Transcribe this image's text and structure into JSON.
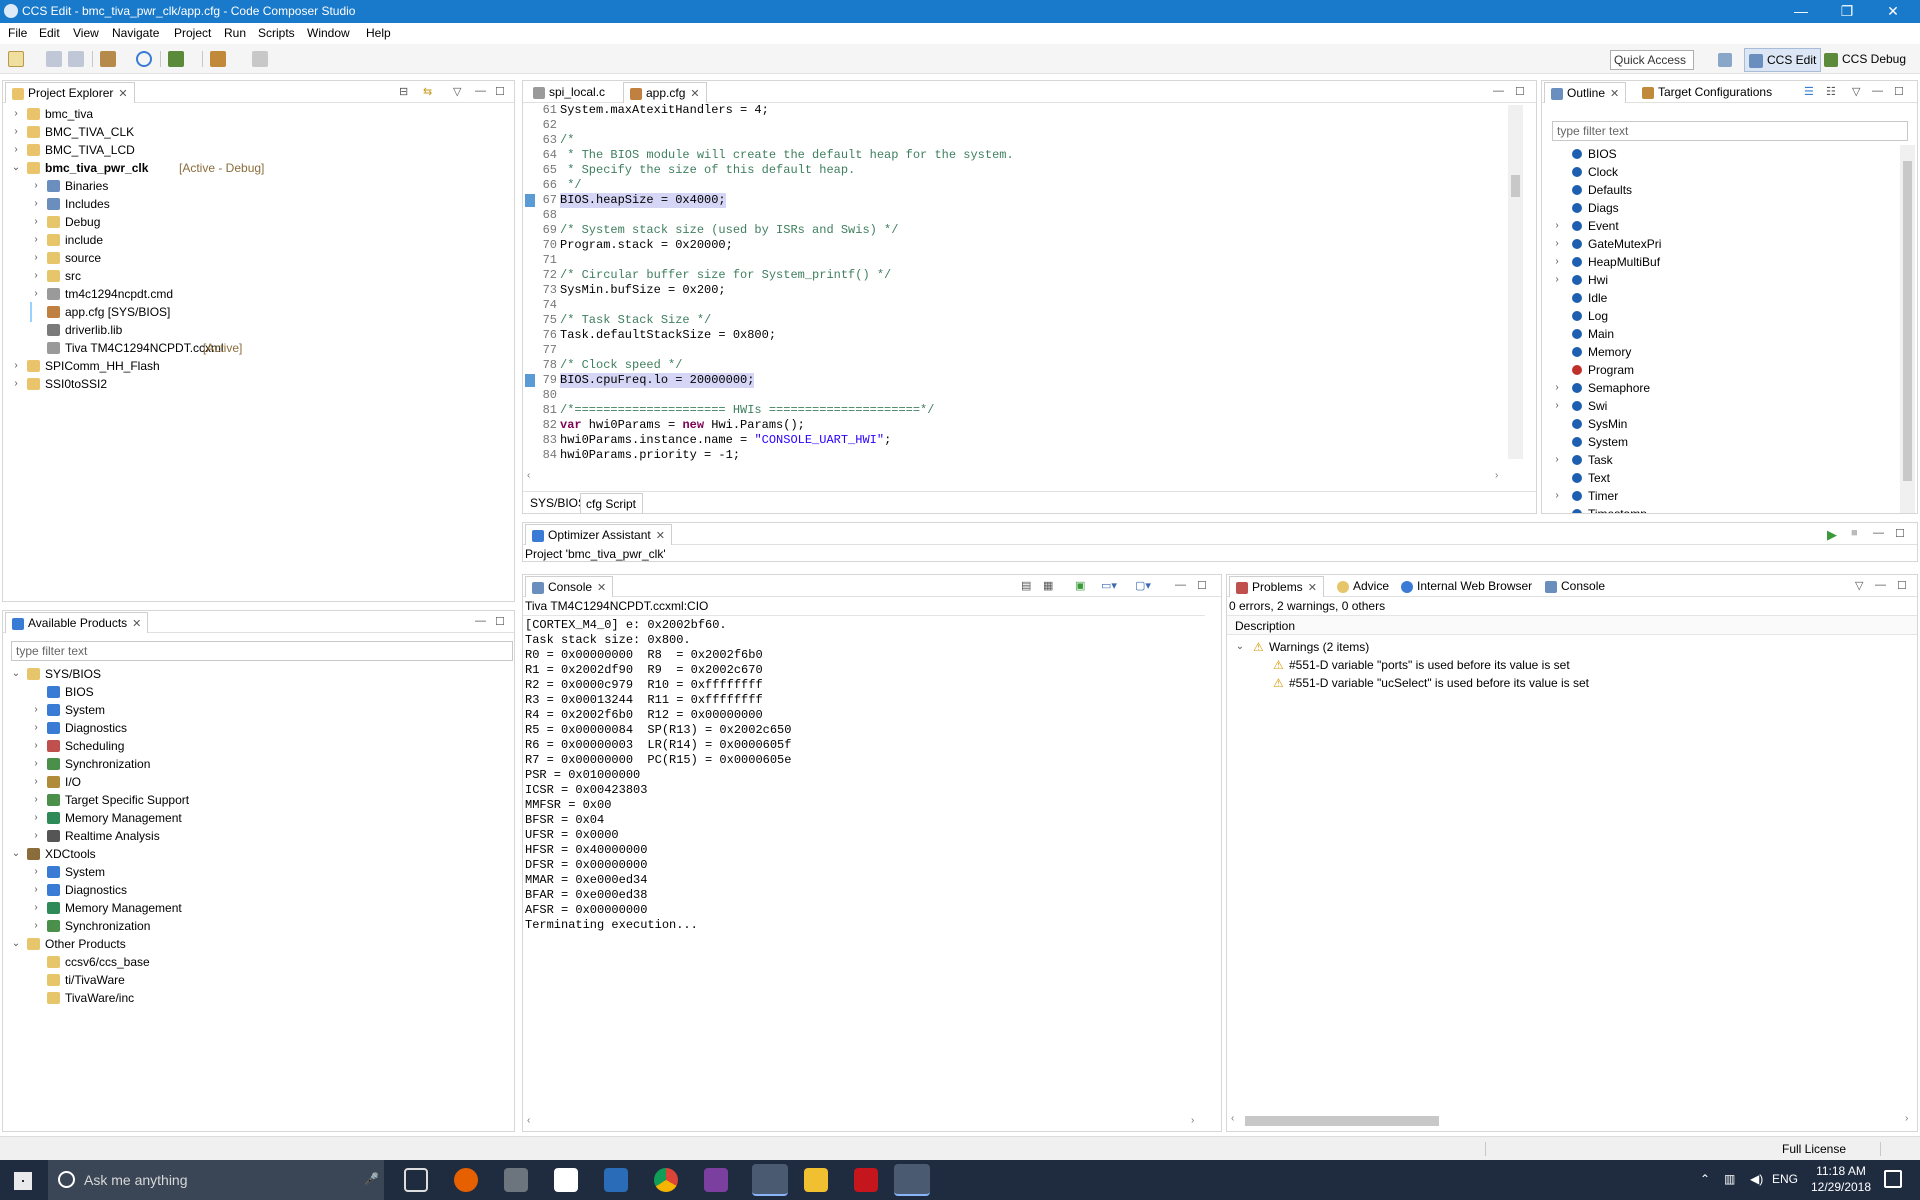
{
  "window": {
    "title": "CCS Edit - bmc_tiva_pwr_clk/app.cfg - Code Composer Studio"
  },
  "menu": [
    "File",
    "Edit",
    "View",
    "Navigate",
    "Project",
    "Run",
    "Scripts",
    "Window",
    "Help"
  ],
  "toolbar": {
    "quick_access": "Quick Access",
    "perspectives": [
      "CCS Edit",
      "CCS Debug"
    ]
  },
  "project_explorer": {
    "title": "Project Explorer",
    "items": [
      {
        "label": "bmc_tiva",
        "indent": 0,
        "arrow": "›",
        "icon": "#e9c46a"
      },
      {
        "label": "BMC_TIVA_CLK",
        "indent": 0,
        "arrow": "›",
        "icon": "#e9c46a"
      },
      {
        "label": "BMC_TIVA_LCD",
        "indent": 0,
        "arrow": "›",
        "icon": "#e9c46a"
      },
      {
        "label": "bmc_tiva_pwr_clk",
        "suffix": "[Active - Debug]",
        "bold": true,
        "indent": 0,
        "arrow": "⌄",
        "icon": "#e9c46a"
      },
      {
        "label": "Binaries",
        "indent": 1,
        "arrow": "›",
        "icon": "#6a8fbf"
      },
      {
        "label": "Includes",
        "indent": 1,
        "arrow": "›",
        "icon": "#6a8fbf"
      },
      {
        "label": "Debug",
        "indent": 1,
        "arrow": "›",
        "icon": "#e7c66b"
      },
      {
        "label": "include",
        "indent": 1,
        "arrow": "›",
        "icon": "#e7c66b"
      },
      {
        "label": "source",
        "indent": 1,
        "arrow": "›",
        "icon": "#e7c66b"
      },
      {
        "label": "src",
        "indent": 1,
        "arrow": "›",
        "icon": "#e7c66b"
      },
      {
        "label": "tm4c1294ncpdt.cmd",
        "indent": 1,
        "arrow": "›",
        "icon": "#9a9a9a"
      },
      {
        "label": "app.cfg [SYS/BIOS]",
        "indent": 1,
        "arrow": "",
        "icon": "#c08040",
        "selected": true
      },
      {
        "label": "driverlib.lib",
        "indent": 1,
        "arrow": "",
        "icon": "#7a7a7a"
      },
      {
        "label": "Tiva TM4C1294NCPDT.ccxml",
        "suffix": "[Active]",
        "indent": 1,
        "arrow": "",
        "icon": "#9a9a9a"
      },
      {
        "label": "SPIComm_HH_Flash",
        "indent": 0,
        "arrow": "›",
        "icon": "#e9c46a"
      },
      {
        "label": "SSI0toSSI2",
        "indent": 0,
        "arrow": "›",
        "icon": "#e9c46a"
      }
    ]
  },
  "available_products": {
    "title": "Available Products",
    "filter_placeholder": "type filter text",
    "items": [
      {
        "label": "SYS/BIOS",
        "indent": 0,
        "arrow": "⌄",
        "icon": "#e7c66b"
      },
      {
        "label": "BIOS",
        "indent": 1,
        "arrow": "",
        "icon": "#3a7bd5"
      },
      {
        "label": "System",
        "indent": 1,
        "arrow": "›",
        "icon": "#3a7bd5"
      },
      {
        "label": "Diagnostics",
        "indent": 1,
        "arrow": "›",
        "icon": "#3a7bd5"
      },
      {
        "label": "Scheduling",
        "indent": 1,
        "arrow": "›",
        "icon": "#c0504d"
      },
      {
        "label": "Synchronization",
        "indent": 1,
        "arrow": "›",
        "icon": "#4a8f4a"
      },
      {
        "label": "I/O",
        "indent": 1,
        "arrow": "›",
        "icon": "#b08b3a"
      },
      {
        "label": "Target Specific Support",
        "indent": 1,
        "arrow": "›",
        "icon": "#4a8f4a"
      },
      {
        "label": "Memory Management",
        "indent": 1,
        "arrow": "›",
        "icon": "#2e8b57"
      },
      {
        "label": "Realtime Analysis",
        "indent": 1,
        "arrow": "›",
        "icon": "#555555"
      },
      {
        "label": "XDCtools",
        "indent": 0,
        "arrow": "⌄",
        "icon": "#8a6d3b"
      },
      {
        "label": "System",
        "indent": 1,
        "arrow": "›",
        "icon": "#3a7bd5"
      },
      {
        "label": "Diagnostics",
        "indent": 1,
        "arrow": "›",
        "icon": "#3a7bd5"
      },
      {
        "label": "Memory Management",
        "indent": 1,
        "arrow": "›",
        "icon": "#2e8b57"
      },
      {
        "label": "Synchronization",
        "indent": 1,
        "arrow": "›",
        "icon": "#4a8f4a"
      },
      {
        "label": "Other Products",
        "indent": 0,
        "arrow": "⌄",
        "icon": "#e7c66b"
      },
      {
        "label": "ccsv6/ccs_base",
        "indent": 1,
        "arrow": "",
        "icon": "#e7c66b"
      },
      {
        "label": "ti/TivaWare",
        "indent": 1,
        "arrow": "",
        "icon": "#e7c66b"
      },
      {
        "label": "TivaWare/inc",
        "indent": 1,
        "arrow": "",
        "icon": "#e7c66b"
      }
    ]
  },
  "editor": {
    "tabs": [
      "spi_local.c",
      "app.cfg"
    ],
    "bottom_tabs": [
      "SYS/BIOS",
      "cfg Script"
    ],
    "lines": [
      {
        "n": "61",
        "t": "System.maxAtexitHandlers = 4;",
        "k": ""
      },
      {
        "n": "62",
        "t": "",
        "k": ""
      },
      {
        "n": "63",
        "t": "/*",
        "k": "cm"
      },
      {
        "n": "64",
        "t": " * The BIOS module will create the default heap for the system.",
        "k": "cm"
      },
      {
        "n": "65",
        "t": " * Specify the size of this default heap.",
        "k": "cm"
      },
      {
        "n": "66",
        "t": " */",
        "k": "cm"
      },
      {
        "n": "67",
        "t": "BIOS.heapSize = 0x4000;",
        "k": "hl"
      },
      {
        "n": "68",
        "t": "",
        "k": ""
      },
      {
        "n": "69",
        "t": "/* System stack size (used by ISRs and Swis) */",
        "k": "cm"
      },
      {
        "n": "70",
        "t": "Program.stack = 0x20000;",
        "k": ""
      },
      {
        "n": "71",
        "t": "",
        "k": ""
      },
      {
        "n": "72",
        "t": "/* Circular buffer size for System_printf() */",
        "k": "cm"
      },
      {
        "n": "73",
        "t": "SysMin.bufSize = 0x200;",
        "k": ""
      },
      {
        "n": "74",
        "t": "",
        "k": ""
      },
      {
        "n": "75",
        "t": "/* Task Stack Size */",
        "k": "cm"
      },
      {
        "n": "76",
        "t": "Task.defaultStackSize = 0x800;",
        "k": ""
      },
      {
        "n": "77",
        "t": "",
        "k": ""
      },
      {
        "n": "78",
        "t": "/* Clock speed */",
        "k": "cm"
      },
      {
        "n": "79",
        "t": "BIOS.cpuFreq.lo = 20000000;",
        "k": "hl"
      },
      {
        "n": "80",
        "t": "",
        "k": ""
      },
      {
        "n": "81",
        "t": "/*===================== HWIs =====================*/",
        "k": "cm"
      },
      {
        "n": "82",
        "t": "var hwi0Params = new Hwi.Params();",
        "k": "var"
      },
      {
        "n": "83",
        "t": "hwi0Params.instance.name = \"CONSOLE_UART_HWI\";",
        "k": "str"
      },
      {
        "n": "84",
        "t": "hwi0Params.priority = -1;",
        "k": ""
      }
    ]
  },
  "outline": {
    "tabs": [
      "Outline",
      "Target Configurations"
    ],
    "filter_placeholder": "type filter text",
    "items": [
      {
        "label": "BIOS",
        "arrow": ""
      },
      {
        "label": "Clock",
        "arrow": ""
      },
      {
        "label": "Defaults",
        "arrow": ""
      },
      {
        "label": "Diags",
        "arrow": ""
      },
      {
        "label": "Event",
        "arrow": "›"
      },
      {
        "label": "GateMutexPri",
        "arrow": "›"
      },
      {
        "label": "HeapMultiBuf",
        "arrow": "›"
      },
      {
        "label": "Hwi",
        "arrow": "›"
      },
      {
        "label": "Idle",
        "arrow": ""
      },
      {
        "label": "Log",
        "arrow": ""
      },
      {
        "label": "Main",
        "arrow": ""
      },
      {
        "label": "Memory",
        "arrow": ""
      },
      {
        "label": "Program",
        "arrow": "",
        "red": true
      },
      {
        "label": "Semaphore",
        "arrow": "›"
      },
      {
        "label": "Swi",
        "arrow": "›"
      },
      {
        "label": "SysMin",
        "arrow": ""
      },
      {
        "label": "System",
        "arrow": ""
      },
      {
        "label": "Task",
        "arrow": "›"
      },
      {
        "label": "Text",
        "arrow": ""
      },
      {
        "label": "Timer",
        "arrow": "›"
      },
      {
        "label": "Timestamp",
        "arrow": ""
      }
    ]
  },
  "optimizer": {
    "title": "Optimizer Assistant",
    "project": "Project 'bmc_tiva_pwr_clk'"
  },
  "console": {
    "title": "Console",
    "source": "Tiva TM4C1294NCPDT.ccxml:CIO",
    "lines": [
      "[CORTEX_M4_0] e: 0x2002bf60.",
      "Task stack size: 0x800.",
      "R0 = 0x00000000  R8  = 0x2002f6b0",
      "R1 = 0x2002df90  R9  = 0x2002c670",
      "R2 = 0x0000c979  R10 = 0xffffffff",
      "R3 = 0x00013244  R11 = 0xffffffff",
      "R4 = 0x2002f6b0  R12 = 0x00000000",
      "R5 = 0x00000084  SP(R13) = 0x2002c650",
      "R6 = 0x00000003  LR(R14) = 0x0000605f",
      "R7 = 0x00000000  PC(R15) = 0x0000605e",
      "PSR = 0x01000000",
      "ICSR = 0x00423803",
      "MMFSR = 0x00",
      "BFSR = 0x04",
      "UFSR = 0x0000",
      "HFSR = 0x40000000",
      "DFSR = 0x00000000",
      "MMAR = 0xe000ed34",
      "BFAR = 0xe000ed38",
      "AFSR = 0x00000000",
      "Terminating execution..."
    ]
  },
  "problems": {
    "tabs": [
      "Problems",
      "Advice",
      "Internal Web Browser",
      "Console"
    ],
    "summary": "0 errors, 2 warnings, 0 others",
    "column": "Description",
    "group": "Warnings (2 items)",
    "warnings": [
      "#551-D variable \"ports\" is used before its value is set",
      "#551-D variable \"ucSelect\" is used before its value is set"
    ]
  },
  "status": {
    "license": "Full License"
  },
  "taskbar": {
    "search_placeholder": "Ask me anything",
    "lang": "ENG",
    "time": "11:18 AM",
    "date": "12/29/2018"
  }
}
